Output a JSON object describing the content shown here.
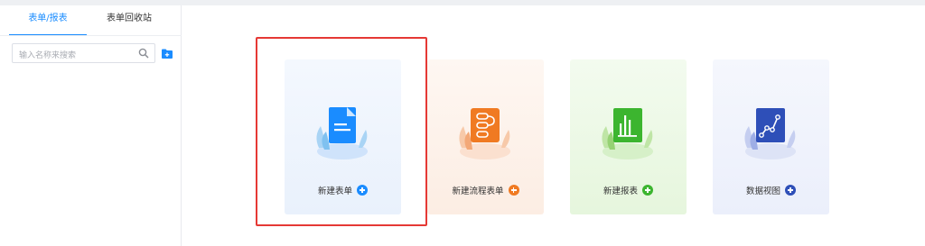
{
  "sidebar": {
    "tabs": [
      {
        "label": "表单/报表"
      },
      {
        "label": "表单回收站"
      }
    ],
    "search": {
      "placeholder": "输入名称来搜索"
    }
  },
  "cards": [
    {
      "label": "新建表单",
      "icon": "form-document-icon",
      "accent": "#1a8cff",
      "bg": "#eef4fd"
    },
    {
      "label": "新建流程表单",
      "icon": "workflow-icon",
      "accent": "#f07a22",
      "bg": "#fdf1ea"
    },
    {
      "label": "新建报表",
      "icon": "bar-chart-icon",
      "accent": "#3cb52f",
      "bg": "#ecf8e6"
    },
    {
      "label": "数据视图",
      "icon": "line-graph-icon",
      "accent": "#2e4fb8",
      "bg": "#eef1fb"
    }
  ]
}
